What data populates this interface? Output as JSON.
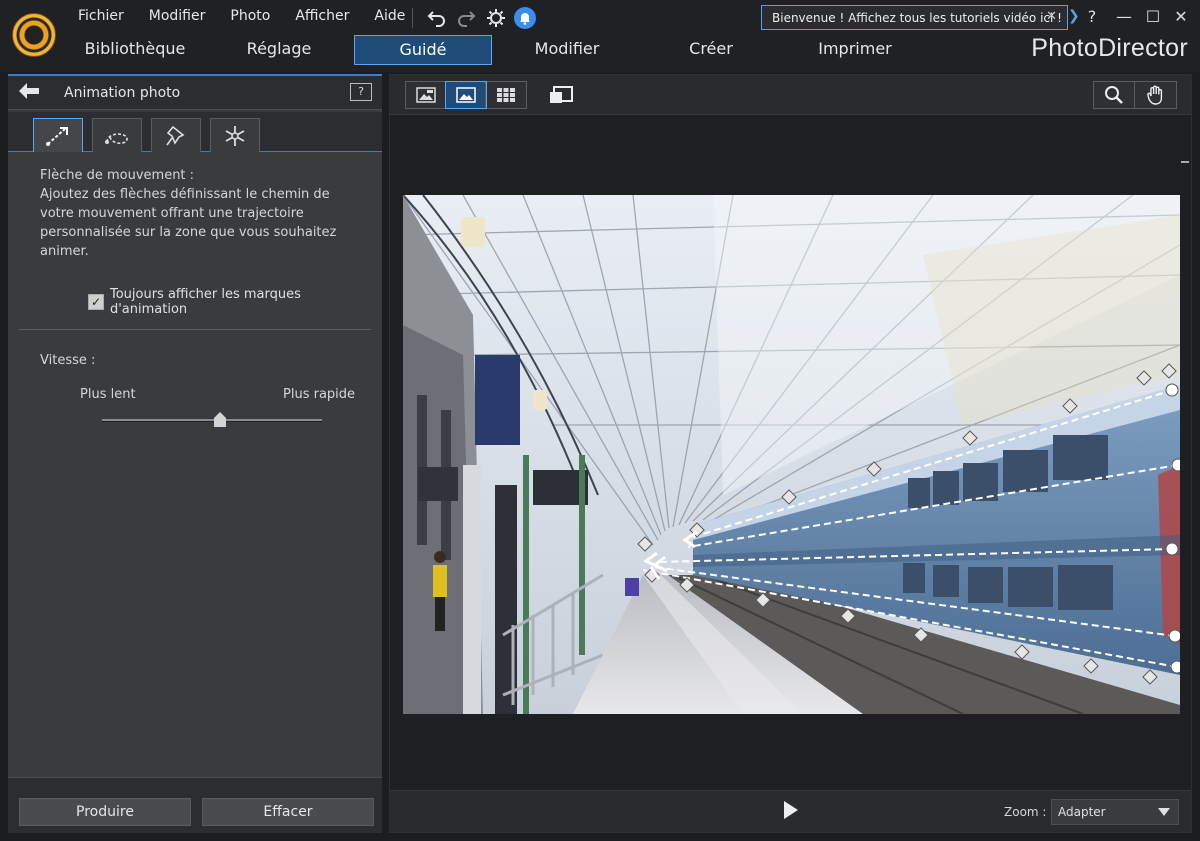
{
  "menu": {
    "items": [
      "Fichier",
      "Modifier",
      "Photo",
      "Afficher",
      "Aide"
    ]
  },
  "toolbar_icons": [
    "undo-icon",
    "redo-icon",
    "settings-icon",
    "notification-icon"
  ],
  "welcome": {
    "text": "Bienvenue ! Affichez tous les tutoriels vidéo ici !",
    "close": "✕"
  },
  "window_controls": {
    "help": "?",
    "minimize": "—",
    "maximize": "☐",
    "close": "✕"
  },
  "tabs": [
    "Bibliothèque",
    "Réglage",
    "Guidé",
    "Modifier",
    "Créer",
    "Imprimer"
  ],
  "active_tab": "Guidé",
  "brand": "PhotoDirector",
  "left_panel": {
    "title": "Animation photo",
    "help_icon_label": "?",
    "tool_tabs": [
      "motion-arrow-icon",
      "loop-path-icon",
      "anchor-pin-icon",
      "freeze-snowflake-icon"
    ],
    "description": {
      "line1": "Flèche de mouvement :",
      "line2": "Ajoutez des flèches définissant le chemin de",
      "line3": "votre mouvement offrant une trajectoire",
      "line4": "personnalisée sur la zone que vous souhaitez",
      "line5": "animer."
    },
    "checkbox_label": "Toujours afficher les marques d'animation",
    "checkbox_checked": true,
    "speed": {
      "label": "Vitesse :",
      "slow": "Plus lent",
      "fast": "Plus rapide",
      "value": 0.5
    },
    "buttons": {
      "produce": "Produire",
      "clear": "Effacer"
    }
  },
  "viewer": {
    "view_modes": [
      "single-view-icon",
      "fit-view-icon",
      "grid-view-icon"
    ],
    "compare_icon": "compare-icon",
    "tools": [
      "zoom-tool-icon",
      "pan-hand-icon"
    ],
    "zoom_label": "Zoom :",
    "zoom_value": "Adapter",
    "play_icon": "play-icon"
  },
  "colors": {
    "accent": "#3d7cc4",
    "active_tab_bg": "#1f4b78",
    "panel_bg": "#3a3b3e"
  }
}
